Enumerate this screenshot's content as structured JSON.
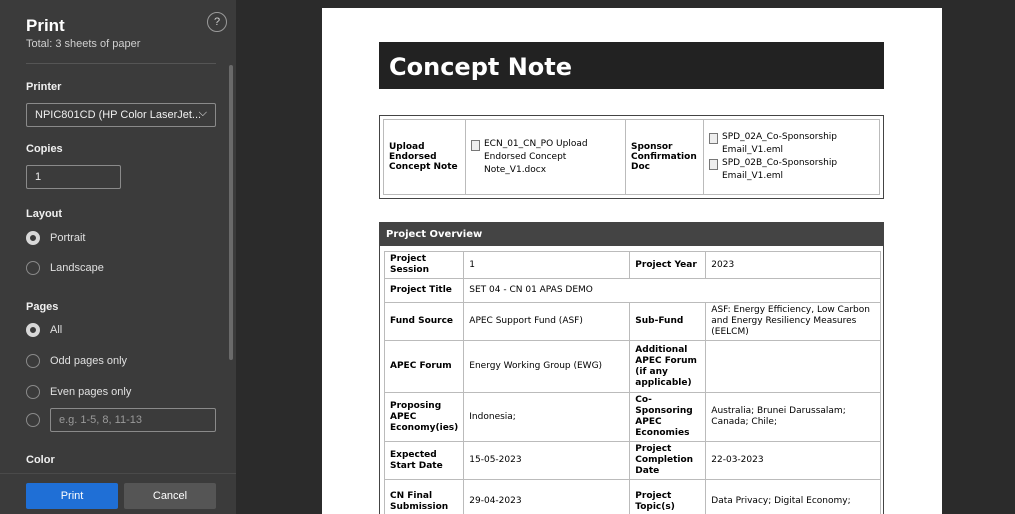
{
  "sidebar": {
    "title": "Print",
    "subtitle": "Total: 3 sheets of paper",
    "help": "?",
    "printer_label": "Printer",
    "printer_value": "NPIC801CD (HP Color LaserJet...",
    "copies_label": "Copies",
    "copies_value": "1",
    "layout_label": "Layout",
    "layout_options": [
      "Portrait",
      "Landscape"
    ],
    "pages_label": "Pages",
    "pages_options": [
      "All",
      "Odd pages only",
      "Even pages only"
    ],
    "range_placeholder": "e.g. 1-5, 8, 11-13",
    "color_label": "Color",
    "print_button": "Print",
    "cancel_button": "Cancel"
  },
  "doc": {
    "title": "Concept Note",
    "upload_label": "Upload Endorsed Concept Note",
    "upload_file": "ECN_01_CN_PO Upload Endorsed Concept Note_V1.docx",
    "sponsor_label": "Sponsor Confirmation Doc",
    "sponsor_files": [
      "SPD_02A_Co-Sponsorship Email_V1.eml",
      "SPD_02B_Co-Sponsorship Email_V1.eml"
    ],
    "overview_title": "Project Overview",
    "rows": [
      {
        "k1": "Project Session",
        "v1": "1",
        "k2": "Project Year",
        "v2": "2023"
      },
      {
        "k1": "Project Title",
        "v1": "SET 04 - CN 01 APAS DEMO",
        "k2": "",
        "v2": ""
      },
      {
        "k1": "Fund Source",
        "v1": "APEC Support Fund (ASF)",
        "k2": "Sub-Fund",
        "v2": "ASF: Energy Efficiency, Low Carbon and Energy Resiliency Measures (EELCM)"
      },
      {
        "k1": "APEC Forum",
        "v1": "Energy Working Group (EWG)",
        "k2": "Additional APEC Forum (if any applicable)",
        "v2": ""
      },
      {
        "k1": "Proposing APEC Economy(ies)",
        "v1": "Indonesia;",
        "k2": "Co-Sponsoring APEC Economies",
        "v2": "Australia; Brunei Darussalam; Canada;  Chile;"
      },
      {
        "k1": "Expected Start Date",
        "v1": "15-05-2023",
        "k2": "Project Completion Date",
        "v2": "22-03-2023"
      },
      {
        "k1": "CN Final Submission",
        "v1": "29-04-2023",
        "k2": "Project Topic(s)",
        "v2": "Data Privacy; Digital Economy;"
      }
    ]
  }
}
